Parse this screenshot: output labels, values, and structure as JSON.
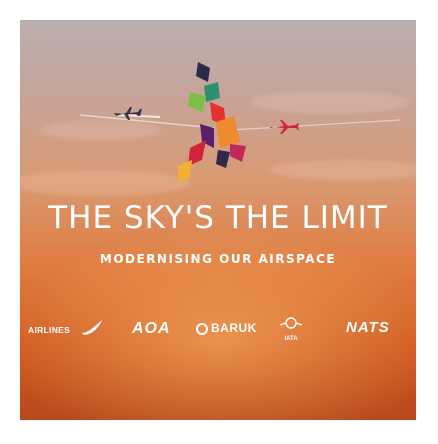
{
  "headline": "THE SKY'S THE LIMIT",
  "subheadline": "MODERNISING OUR AIRSPACE",
  "logos": [
    {
      "name": "airlines-uk-logo",
      "text": "AIRLINES"
    },
    {
      "name": "aoa-logo",
      "text": "AOA"
    },
    {
      "name": "barUK-logo",
      "text": "BARUK"
    },
    {
      "name": "iata-logo",
      "text": "IATA"
    },
    {
      "name": "nats-logo",
      "text": "NATS"
    }
  ],
  "colors": {
    "sky_top": "#b9b0ae",
    "sky_bottom": "#b8491b",
    "accent_red": "#d1233c",
    "accent_orange": "#f08a2e",
    "accent_green": "#6aa84f",
    "accent_purple": "#6a2c7a",
    "text": "#ffffff"
  }
}
